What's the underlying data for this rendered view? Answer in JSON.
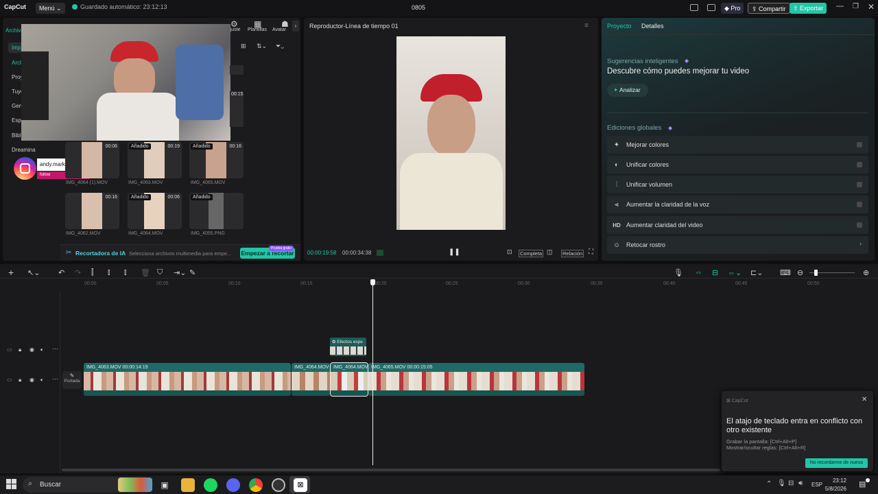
{
  "titlebar": {
    "logo": "CapCut",
    "menu": "Menú ⌄",
    "autosave": "Guardado automático: 23:12:13",
    "project_title": "0805",
    "pro": "Pro",
    "share": "Compartir",
    "export": "Exportar"
  },
  "toolbar": {
    "tabs": [
      "Ajuste",
      "Plantillas",
      "Avatar"
    ]
  },
  "sidebar": {
    "items": [
      "Archivo",
      "Imp",
      "Arch",
      "Proy",
      "Tuyo",
      "Gen",
      "Esp",
      "Bibl",
      "Dreamina"
    ]
  },
  "media": {
    "row1": [
      {
        "badge": "",
        "duration": "00:06",
        "name": "IMG_4064 (1).MOV"
      },
      {
        "badge": "Añadido",
        "duration": "00:19",
        "name": "IMG_4063.MOV"
      },
      {
        "badge": "Añadido",
        "duration": "00:16",
        "name": "IMG_4065.MOV"
      }
    ],
    "row2": [
      {
        "badge": "",
        "duration": "00:16",
        "name": "IMG_4062.MOV"
      },
      {
        "badge": "Añadido",
        "duration": "00:06",
        "name": "IMG_4064.MOV"
      },
      {
        "badge": "Añadido",
        "duration": "",
        "name": "IMG_4055.PNG"
      }
    ],
    "top_duration": "00:15",
    "instagram_handle": "andy.markt",
    "instagram_follow": "follow",
    "ai_cropper_label": "Recortadora de IA",
    "ai_cropper_hint": "Selecciona archivos multimedia para empe...",
    "ai_cropper_button": "Empezar a recortar",
    "ai_cropper_tag": "Prueba gratis"
  },
  "player": {
    "title": "Reproductor-Línea de tiempo 01",
    "current_time": "00:00:19:58",
    "total_time": "00:00:34:38",
    "full_label": "Completa",
    "ratio_label": "Relación"
  },
  "right_panel": {
    "tabs": [
      "Proyecto",
      "Detalles"
    ],
    "suggest_title": "Sugerencias inteligentes",
    "suggest_sub": "Descubre cómo puedes mejorar tu video",
    "analyze": "Analizar",
    "global_title": "Ediciones globales",
    "options": [
      {
        "icon": "✦",
        "label": "Mejorar colores"
      },
      {
        "icon": "◐",
        "label": "Unificar colores"
      },
      {
        "icon": "⫶",
        "label": "Unificar volumen"
      },
      {
        "icon": "⫷",
        "label": "Aumentar la claridad de la voz"
      },
      {
        "icon": "HD",
        "label": "Aumentar claridad del video"
      },
      {
        "icon": "☺",
        "label": "Retocar rostro"
      }
    ]
  },
  "timeline": {
    "ruler": [
      "00:00",
      "00:05",
      "00:10",
      "00:15",
      "00:20",
      "00:25",
      "00:30",
      "00:35",
      "00:40",
      "00:45",
      "00:50"
    ],
    "effects_label": "Efectos espe",
    "cover_label": "Portada",
    "clips": [
      {
        "label": "IMG_4063.MOV   00:00:14:19"
      },
      {
        "label": "IMG_4064.MOV"
      },
      {
        "label": "IMG_4064.MOV"
      },
      {
        "label": "IMG_4065.MOV   00:00:15:05"
      }
    ]
  },
  "toast": {
    "app": "CapCut",
    "title": "El atajo de teclado entra en conflicto con otro existente",
    "line1": "Grabar la pantalla: [Ctrl+Alt+P]",
    "line2": "Mostrar/ocultar reglas: [Ctrl+Alt+R]",
    "button": "No recordarme de nuevo"
  },
  "taskbar": {
    "search": "Buscar",
    "lang": "ESP",
    "time": "23:12",
    "date": "5/8/2026"
  },
  "colors": {
    "accent": "#22c5a6",
    "bg": "#0f0f10",
    "panel": "#1b1b1d"
  }
}
